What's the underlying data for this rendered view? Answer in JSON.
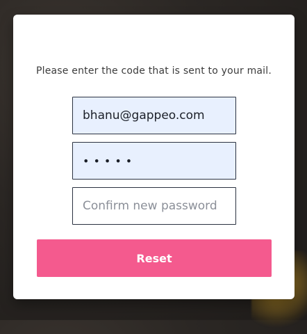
{
  "modal": {
    "instruction": "Please enter the code that is sent to your mail."
  },
  "form": {
    "email_value": "bhanu@gappeo.com",
    "password_value": "•••••",
    "confirm_placeholder": "Confirm new password",
    "reset_label": "Reset"
  },
  "colors": {
    "accent": "#f45a8e",
    "input_filled_bg": "#e8f0fe",
    "input_border": "#2a3140"
  }
}
